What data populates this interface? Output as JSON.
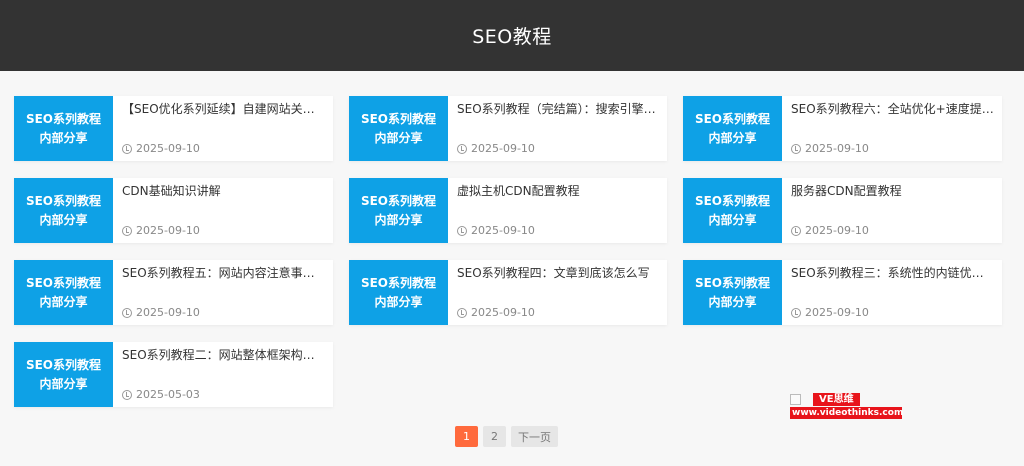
{
  "header": {
    "title": "SEO教程"
  },
  "cards": [
    {
      "thumb_line1": "SEO系列教程",
      "thumb_line2": "内部分享",
      "title": "【SEO优化系列延续】自建网站关键词…",
      "date": "2025-09-10"
    },
    {
      "thumb_line1": "SEO系列教程",
      "thumb_line2": "内部分享",
      "title": "SEO系列教程（完结篇）：搜索引擎的…",
      "date": "2025-09-10"
    },
    {
      "thumb_line1": "SEO系列教程",
      "thumb_line2": "内部分享",
      "title": "SEO系列教程六：全站优化+速度提升…",
      "date": "2025-09-10"
    },
    {
      "thumb_line1": "SEO系列教程",
      "thumb_line2": "内部分享",
      "title": "CDN基础知识讲解",
      "date": "2025-09-10"
    },
    {
      "thumb_line1": "SEO系列教程",
      "thumb_line2": "内部分享",
      "title": "虚拟主机CDN配置教程",
      "date": "2025-09-10"
    },
    {
      "thumb_line1": "SEO系列教程",
      "thumb_line2": "内部分享",
      "title": "服务器CDN配置教程",
      "date": "2025-09-10"
    },
    {
      "thumb_line1": "SEO系列教程",
      "thumb_line2": "内部分享",
      "title": "SEO系列教程五：网站内容注意事项+…",
      "date": "2025-09-10"
    },
    {
      "thumb_line1": "SEO系列教程",
      "thumb_line2": "内部分享",
      "title": "SEO系列教程四：文章到底该怎么写",
      "date": "2025-09-10"
    },
    {
      "thumb_line1": "SEO系列教程",
      "thumb_line2": "内部分享",
      "title": "SEO系列教程三：系统性的内链优化讲…",
      "date": "2025-09-10"
    },
    {
      "thumb_line1": "SEO系列教程",
      "thumb_line2": "内部分享",
      "title": "SEO系列教程二：网站整体框架构建思…",
      "date": "2025-05-03"
    }
  ],
  "pagination": {
    "pages": [
      "1",
      "2"
    ],
    "current": "1",
    "next_label": "下一页"
  },
  "watermark": {
    "name": "VE思维",
    "url": "www.videothinks.com"
  },
  "colors": {
    "header_bg": "#333333",
    "thumb_bg": "#0ea1e6",
    "active_page": "#ff6a3d",
    "watermark_red": "#e8141b"
  }
}
